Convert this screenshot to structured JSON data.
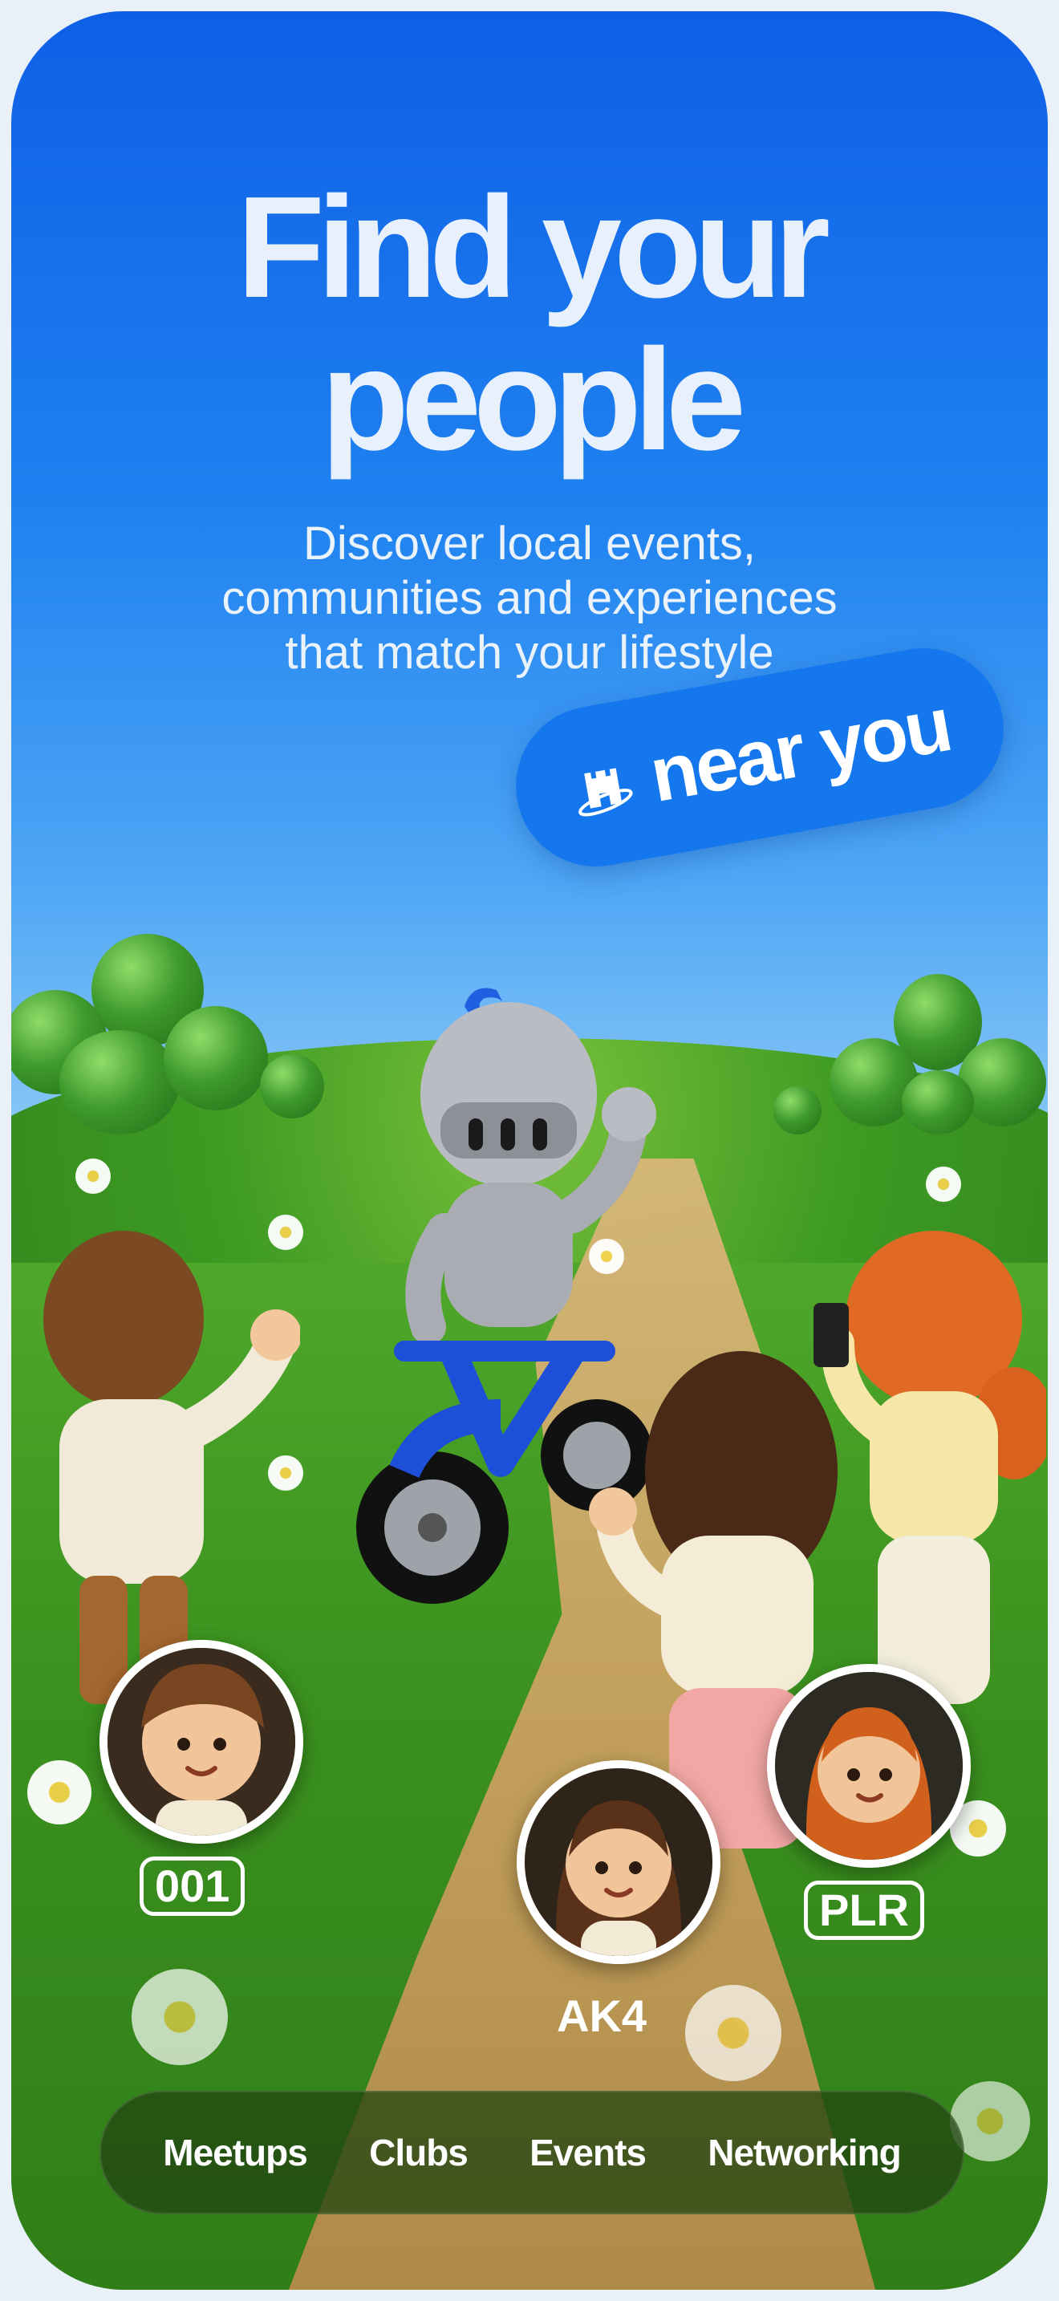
{
  "hero": {
    "title_line1": "Find your",
    "title_line2": "people",
    "subtitle_line1": "Discover local events,",
    "subtitle_line2": "communities and experiences",
    "subtitle_line3": "that match your lifestyle",
    "near_badge": "near you"
  },
  "avatars": [
    {
      "tag": "001"
    },
    {
      "tag": "AK4"
    },
    {
      "tag": "PLR"
    }
  ],
  "categories": [
    "Meetups",
    "Clubs",
    "Events",
    "Networking"
  ],
  "colors": {
    "sky_top": "#0e5fe6",
    "accent_pill": "#1577ee",
    "grass": "#3b921f",
    "bar_bg": "#22461299"
  },
  "icons": {
    "near_badge_icon": "castle-icon"
  }
}
